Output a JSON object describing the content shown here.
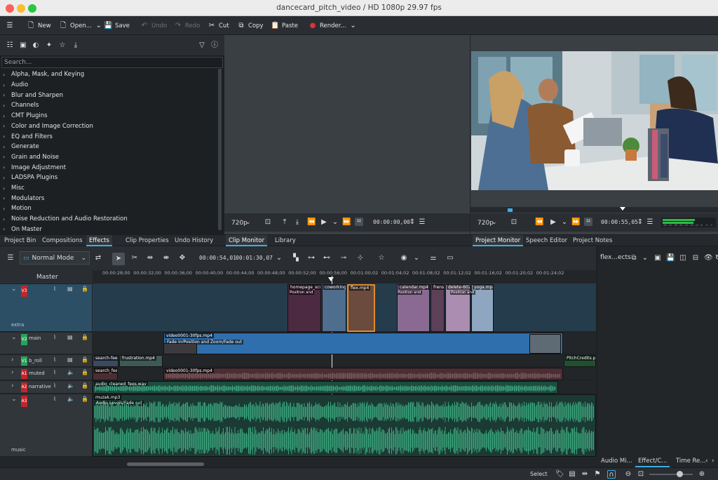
{
  "window": {
    "title": "dancecard_pitch_video / HD 1080p 29.97 fps"
  },
  "toolbar": {
    "new": "New",
    "open": "Open...",
    "save": "Save",
    "undo": "Undo",
    "redo": "Redo",
    "cut": "Cut",
    "copy": "Copy",
    "paste": "Paste",
    "render": "Render..."
  },
  "effects": {
    "search_placeholder": "Search...",
    "categories": [
      "Alpha, Mask, and Keying",
      "Audio",
      "Blur and Sharpen",
      "Channels",
      "CMT Plugins",
      "Color and Image Correction",
      "EQ and Filters",
      "Generate",
      "Grain and Noise",
      "Image Adjustment",
      "LADSPA Plugins",
      "Misc",
      "Modulators",
      "Motion",
      "Noise Reduction and Audio Restoration",
      "On Master"
    ]
  },
  "clip_monitor": {
    "resolution": "720p",
    "timecode": "00:00:00,00"
  },
  "project_monitor": {
    "resolution": "720p",
    "timecode": "00:00:55,05",
    "meter_labels": [
      "-48",
      "-42",
      "-36",
      "-30",
      "-24",
      "-18",
      "-12",
      "-6",
      "-3",
      "0"
    ]
  },
  "tabs": {
    "left": [
      "Project Bin",
      "Compositions",
      "Effects",
      "Clip Properties",
      "Undo History",
      "Clip Monitor",
      "Library"
    ],
    "right": [
      "Project Monitor",
      "Speech Editor",
      "Project Notes"
    ]
  },
  "timeline": {
    "mode": "Normal Mode",
    "position": "00:00:54,01",
    "duration": "00:01:30,07",
    "master": "Master",
    "ruler": [
      "00:00:28;00",
      "00:00:32;00",
      "00:00:36;00",
      "00:00:40;00",
      "00:00:44;00",
      "00:00:48;00",
      "00:00:52;00",
      "00:00:56;00",
      "00:01:00;02",
      "00:01:04;02",
      "00:01:08;02",
      "00:01:12;02",
      "00:01:16;02",
      "00:01:20;02",
      "00:01:24;02"
    ]
  },
  "tracks": [
    {
      "id": "V3",
      "name": "",
      "sub": "extra"
    },
    {
      "id": "V2",
      "name": "main",
      "sub": ""
    },
    {
      "id": "V1",
      "name": "b_roll",
      "sub": ""
    },
    {
      "id": "A1",
      "name": "muted",
      "sub": ""
    },
    {
      "id": "A2",
      "name": "narrative",
      "sub": ""
    },
    {
      "id": "A3",
      "name": "",
      "sub": "music"
    }
  ],
  "clips": {
    "homepage": "homepage_scr",
    "coworking": "coworking",
    "flex": "flex.mp4",
    "calendar": "calendar.mp4",
    "frens": "frens.",
    "delete": "delete-602",
    "yoga": "yoga.mp4",
    "position1": "Position and",
    "position2": "Position and",
    "position3": "Position and",
    "video0001": "video0001-30fps.mp4",
    "fade": "Fade in/Position and Zoom/Fade out",
    "search": "search-fee",
    "frustration": "frustration.mp4",
    "pitchcredits": "PitchCredits.p",
    "search2": "search_fee",
    "video0001b": "video0001-30fps.mp4",
    "audio_cleaned": "audio_cleaned_fees.wav",
    "muzak": "muzak.mp3",
    "audio_levels": "Audio Levels/Fade out"
  },
  "side": {
    "title": "flex...ects"
  },
  "bottom_tabs": [
    "Audio Mi...",
    "Effect/C...",
    "Time Re..."
  ],
  "status": {
    "select": "Select"
  },
  "colors": {
    "accent": "#3daee9",
    "video_clip": "#2f6fae",
    "audio_clip": "#2f8a6e",
    "track_red": "#c0262c",
    "track_green": "#27a35a",
    "selected": "#e08a2c"
  }
}
